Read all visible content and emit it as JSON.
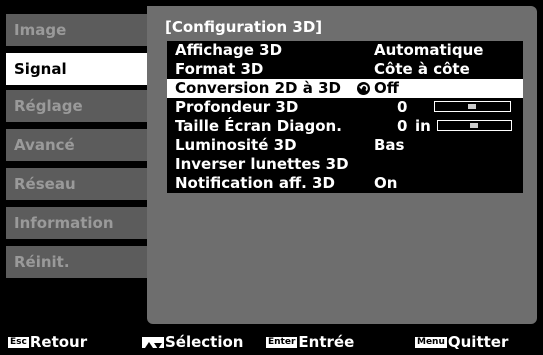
{
  "sidebar": {
    "items": [
      {
        "label": "Image",
        "active": false
      },
      {
        "label": "Signal",
        "active": true
      },
      {
        "label": "Réglage",
        "active": false
      },
      {
        "label": "Avancé",
        "active": false
      },
      {
        "label": "Réseau",
        "active": false
      },
      {
        "label": "Information",
        "active": false
      },
      {
        "label": "Réinit.",
        "active": false
      }
    ]
  },
  "panel": {
    "title": "[Configuration 3D]",
    "rows": [
      {
        "label": "Affichage 3D",
        "value": "Automatique"
      },
      {
        "label": "Format 3D",
        "value": "Côte à côte"
      },
      {
        "label": "Conversion 2D à 3D",
        "value": "Off",
        "selected": true,
        "icon": "undo-icon"
      },
      {
        "label": "Profondeur 3D",
        "value": "0",
        "slider_level": 0.5
      },
      {
        "label": "Taille Écran Diagon.",
        "value": "0",
        "unit": "in",
        "slider_level": 0.5
      },
      {
        "label": "Luminosité 3D",
        "value": "Bas"
      },
      {
        "label": "Inverser lunettes 3D",
        "value": ""
      },
      {
        "label": "Notification aff. 3D",
        "value": "On"
      }
    ]
  },
  "footer": {
    "back": {
      "key": "Esc",
      "label": "Retour"
    },
    "select": {
      "key_icon": "up-down-arrow-icon",
      "label": "Sélection"
    },
    "enter": {
      "key": "Enter",
      "label": "Entrée"
    },
    "quit": {
      "key": "Menu",
      "label": "Quitter"
    }
  }
}
